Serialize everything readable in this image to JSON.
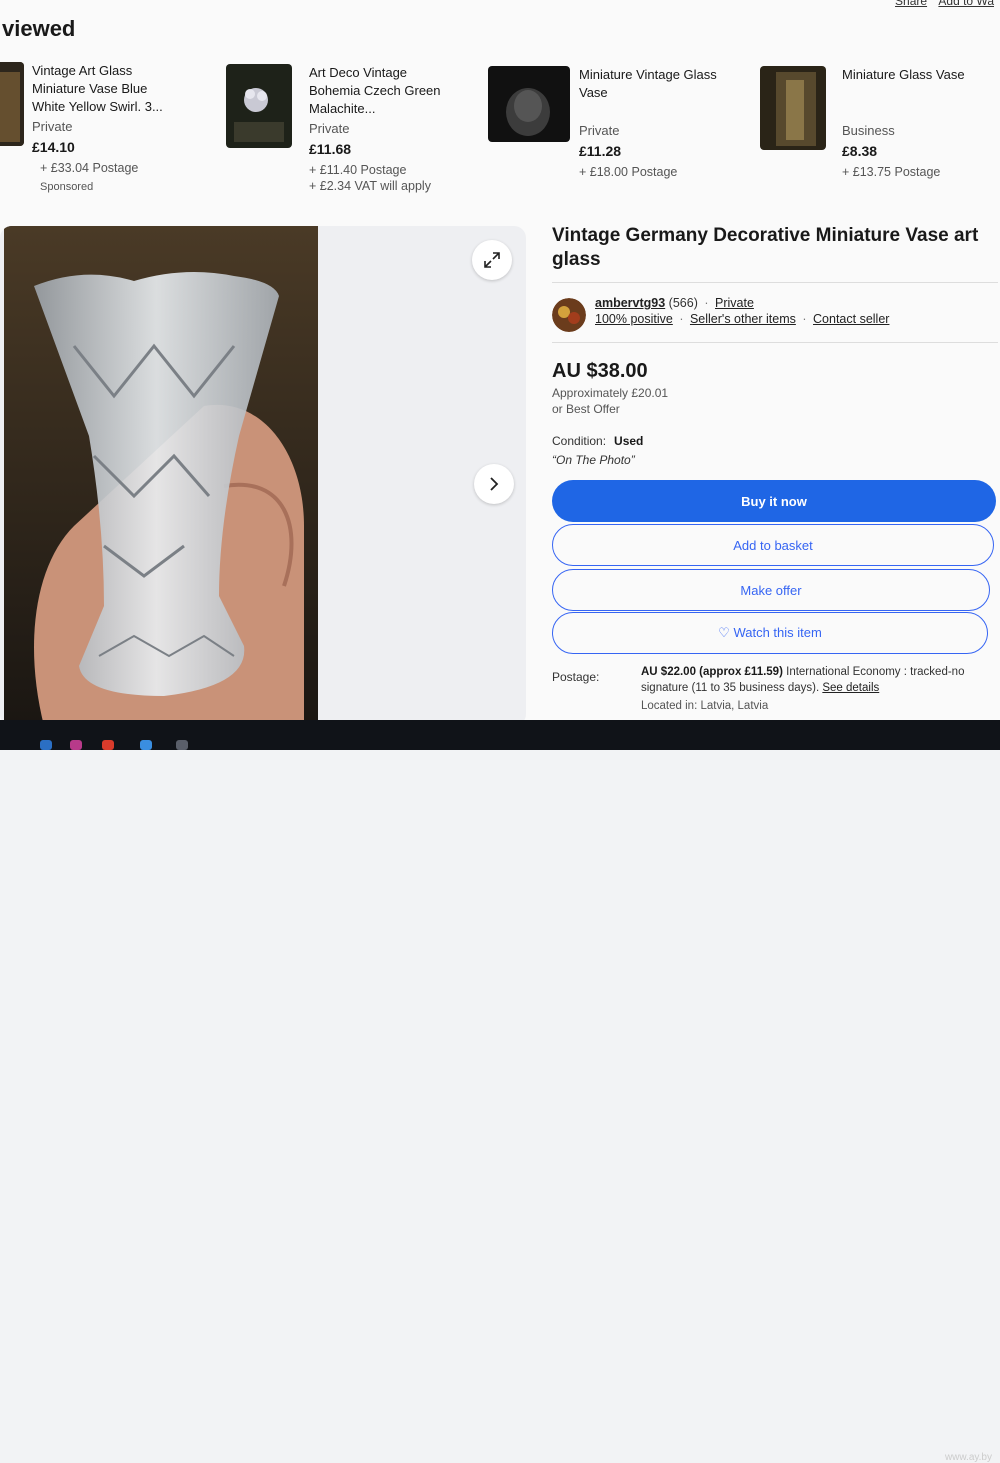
{
  "header": {
    "section_title": "viewed",
    "top_links": [
      "Share",
      "Add to Wa"
    ]
  },
  "recently_viewed": [
    {
      "title": "Vintage Art Glass Miniature Vase Blue White Yellow Swirl. 3...",
      "seller_type": "Private",
      "price": "£14.10",
      "postage": "+ £33.04 Postage",
      "extra": "",
      "sponsored": "Sponsored"
    },
    {
      "title": "Art Deco Vintage Bohemia Czech Green Malachite...",
      "seller_type": "Private",
      "price": "£11.68",
      "postage": "+ £11.40 Postage",
      "extra": "+ £2.34 VAT will apply",
      "sponsored": ""
    },
    {
      "title": "Miniature Vintage Glass Vase",
      "seller_type": "Private",
      "price": "£11.28",
      "postage": "+ £18.00 Postage",
      "extra": "",
      "sponsored": ""
    },
    {
      "title": "Miniature Glass Vase",
      "seller_type": "Business",
      "price": "£8.38",
      "postage": "+ £13.75 Postage",
      "extra": "",
      "sponsored": ""
    }
  ],
  "item": {
    "title": "Vintage Germany Decorative Miniature Vase art glass",
    "seller": {
      "name": "ambervtg93",
      "feedback_count": "(566)",
      "type": "Private",
      "positive": "100% positive",
      "other_items": "Seller's other items",
      "contact": "Contact seller"
    },
    "price": "AU $38.00",
    "approx": "Approximately £20.01",
    "best_offer": "or Best Offer",
    "condition_label": "Condition:",
    "condition_value": "Used",
    "condition_note": "“On The Photo”",
    "buttons": {
      "buy": "Buy it now",
      "basket": "Add to basket",
      "offer": "Make offer",
      "watch": "♡ Watch this item"
    },
    "postage_label": "Postage:",
    "postage_price": "AU $22.00 (approx £11.59)",
    "postage_desc": "International Economy : tracked-no signature (11 to 35 business days).",
    "see_details": "See details",
    "located": "Located in: Latvia, Latvia"
  },
  "watermark": "www.ay.by",
  "colors": {
    "primary_blue": "#3665f3",
    "buy_button": "#1f66e5"
  }
}
